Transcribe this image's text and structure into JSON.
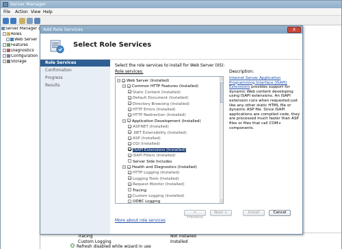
{
  "parent": {
    "title": "Server Manager",
    "menu": [
      "File",
      "Action",
      "View",
      "Help"
    ],
    "tree": [
      {
        "label": "Server Manager (W",
        "level": 0
      },
      {
        "label": "Roles",
        "level": 1
      },
      {
        "label": "Web Server",
        "level": 2
      },
      {
        "label": "Features",
        "level": 1
      },
      {
        "label": "Diagnostics",
        "level": 1
      },
      {
        "label": "Configuration",
        "level": 1
      },
      {
        "label": "Storage",
        "level": 1
      }
    ],
    "background_rows": [
      {
        "name": "Tracing",
        "status": "Not installed"
      },
      {
        "name": "Custom Logging",
        "status": "Installed"
      }
    ],
    "status_text": "Refresh disabled while wizard in use"
  },
  "dialog": {
    "title": "Add Role Services",
    "close_label": "X",
    "header_title": "Select Role Services",
    "nav": [
      {
        "label": "Role Services",
        "active": true
      },
      {
        "label": "Confirmation",
        "active": false
      },
      {
        "label": "Progress",
        "active": false
      },
      {
        "label": "Results",
        "active": false
      }
    ],
    "intro": "Select the role services to install for Web Server (IIS):",
    "role_services_label": "Role services:",
    "description_label": "Description:",
    "description_link": "Internet Server Application Programming Interface (ISAPI) Extensions",
    "description_text": " provides support for dynamic Web content developing using ISAPI extensions. An ISAPI extension runs when requested just like any other static HTML file or dynamic ASP file. Since ISAPI applications are compiled code, they are processed much faster than ASP files or files that call COM+ components.",
    "role_services": [
      {
        "label": "Web Server  (Installed)",
        "level": 0,
        "kind": "cat"
      },
      {
        "label": "Common HTTP Features  (Installed)",
        "level": 1,
        "kind": "cat"
      },
      {
        "label": "Static Content  (Installed)",
        "level": 2,
        "kind": "inst"
      },
      {
        "label": "Default Document  (Installed)",
        "level": 2,
        "kind": "inst"
      },
      {
        "label": "Directory Browsing  (Installed)",
        "level": 2,
        "kind": "inst"
      },
      {
        "label": "HTTP Errors  (Installed)",
        "level": 2,
        "kind": "inst"
      },
      {
        "label": "HTTP Redirection  (Installed)",
        "level": 2,
        "kind": "inst"
      },
      {
        "label": "Application Development  (Installed)",
        "level": 1,
        "kind": "cat"
      },
      {
        "label": "ASP.NET  (Installed)",
        "level": 2,
        "kind": "inst"
      },
      {
        "label": ".NET Extensibility  (Installed)",
        "level": 2,
        "kind": "inst"
      },
      {
        "label": "ASP  (Installed)",
        "level": 2,
        "kind": "inst"
      },
      {
        "label": "CGI  (Installed)",
        "level": 2,
        "kind": "inst"
      },
      {
        "label": "ISAPI Extensions  (Installed)",
        "level": 2,
        "kind": "selected"
      },
      {
        "label": "ISAPI Filters  (Installed)",
        "level": 2,
        "kind": "inst"
      },
      {
        "label": "Server Side Includes",
        "level": 2,
        "kind": "unchecked"
      },
      {
        "label": "Health and Diagnostics  (Installed)",
        "level": 1,
        "kind": "cat"
      },
      {
        "label": "HTTP Logging  (Installed)",
        "level": 2,
        "kind": "inst"
      },
      {
        "label": "Logging Tools  (Installed)",
        "level": 2,
        "kind": "inst"
      },
      {
        "label": "Request Monitor  (Installed)",
        "level": 2,
        "kind": "inst"
      },
      {
        "label": "Tracing",
        "level": 2,
        "kind": "unchecked"
      },
      {
        "label": "Custom Logging  (Installed)",
        "level": 2,
        "kind": "inst"
      },
      {
        "label": "ODBC Logging",
        "level": 2,
        "kind": "unchecked"
      }
    ],
    "more_link": "More about role services",
    "buttons": {
      "previous": "< Previous",
      "next": "Next >",
      "install": "Install",
      "cancel": "Cancel"
    }
  },
  "colors": {
    "nav_active": "#2d5f92",
    "selection": "#1b3d75",
    "link": "#1c4ea8"
  }
}
